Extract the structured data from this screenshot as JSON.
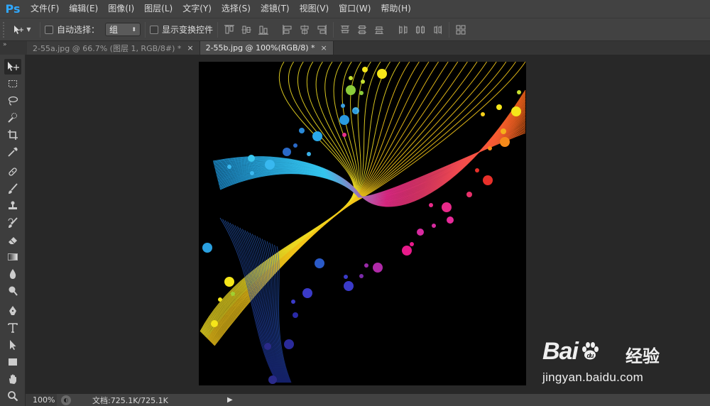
{
  "app": {
    "logo": "Ps"
  },
  "menu": [
    {
      "label": "文件(F)"
    },
    {
      "label": "编辑(E)"
    },
    {
      "label": "图像(I)"
    },
    {
      "label": "图层(L)"
    },
    {
      "label": "文字(Y)"
    },
    {
      "label": "选择(S)"
    },
    {
      "label": "滤镜(T)"
    },
    {
      "label": "视图(V)"
    },
    {
      "label": "窗口(W)"
    },
    {
      "label": "帮助(H)"
    }
  ],
  "options": {
    "auto_select_label": "自动选择：",
    "auto_select_value": "组",
    "show_transform_label": "显示变换控件",
    "auto_select_checked": false,
    "show_transform_checked": false
  },
  "tabs": [
    {
      "label": "2-55a.jpg @ 66.7% (图层 1, RGB/8#) *",
      "active": false
    },
    {
      "label": "2-55b.jpg @ 100%(RGB/8) *",
      "active": true
    }
  ],
  "tools": [
    {
      "icon": "move-tool-icon"
    },
    {
      "icon": "rectangular-marquee-icon"
    },
    {
      "icon": "lasso-icon"
    },
    {
      "icon": "quick-selection-icon"
    },
    {
      "icon": "crop-icon"
    },
    {
      "icon": "eyedropper-icon"
    },
    {
      "icon": "healing-brush-icon"
    },
    {
      "icon": "brush-icon"
    },
    {
      "icon": "clone-stamp-icon"
    },
    {
      "icon": "history-brush-icon"
    },
    {
      "icon": "eraser-icon"
    },
    {
      "icon": "gradient-icon"
    },
    {
      "icon": "blur-icon"
    },
    {
      "icon": "dodge-icon"
    },
    {
      "icon": "pen-icon"
    },
    {
      "icon": "type-icon"
    },
    {
      "icon": "path-selection-icon"
    },
    {
      "icon": "rectangle-shape-icon"
    },
    {
      "icon": "hand-icon"
    },
    {
      "icon": "zoom-icon"
    }
  ],
  "status": {
    "zoom": "100%",
    "doc_info": "文档:725.1K/725.1K"
  },
  "watermark": {
    "brand": "Bai",
    "brand_cn": "经验",
    "url": "jingyan.baidu.com"
  },
  "colors": {
    "ps_blue": "#30a8ff",
    "panel": "#424242",
    "workspace": "#282828"
  }
}
